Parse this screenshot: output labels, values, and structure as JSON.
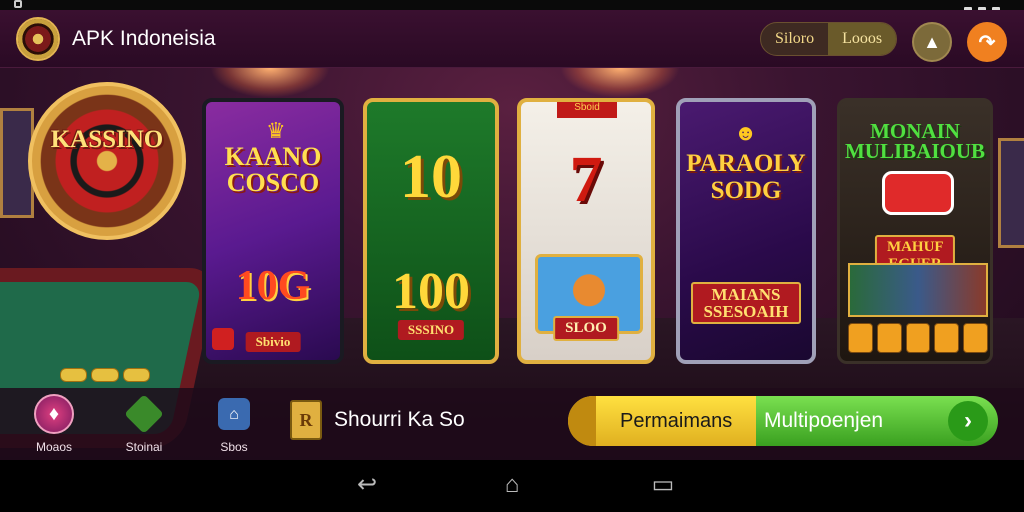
{
  "header": {
    "title": "APK Indoneisia",
    "pill_tabs": [
      "Siloro",
      "Looos"
    ],
    "bell_icon": "bell-icon",
    "share_icon": "share-icon"
  },
  "scene": {
    "roulette_label": "KASSINO"
  },
  "cards": [
    {
      "title": "KAANO COSCO",
      "number": "10G",
      "banner": "Sbivio"
    },
    {
      "number_top": "10",
      "number_bottom": "100",
      "banner": "SSSINO"
    },
    {
      "top_tag": "Sboid",
      "number": "7",
      "banner": "SLOO"
    },
    {
      "title": "PARAOLY SODG",
      "banner": "MAIANS SSESOAIH"
    },
    {
      "title": "MONAIN MULIBAIOUB",
      "banner": "MAHUF EGUER"
    }
  ],
  "bottom_nav": [
    {
      "label": "Moaos",
      "icon": "dice-icon"
    },
    {
      "label": "Stoinai",
      "icon": "home-icon"
    },
    {
      "label": "Sbos",
      "icon": "shield-icon"
    }
  ],
  "shop": {
    "label": "Shourri Ka So",
    "icon_glyph": "R"
  },
  "cta": {
    "left_label": "Permaimans",
    "right_label": "Multipoenjen",
    "arrow_glyph": "›"
  },
  "android_nav": {
    "back": "↩",
    "home": "⌂",
    "recents": "▭"
  },
  "colors": {
    "header_bg": "#2a0a24",
    "cta_yellow": "#ffe040",
    "cta_green": "#3aa020",
    "share_orange": "#f08020"
  }
}
